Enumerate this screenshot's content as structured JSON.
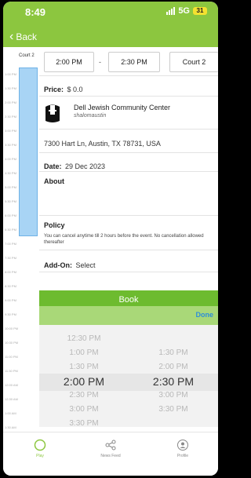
{
  "status_bar": {
    "time": "8:49",
    "network": "5G",
    "battery": "31"
  },
  "nav": {
    "back_label": "Back"
  },
  "schedule": {
    "court_label": "Court 2",
    "time_labels": [
      "1:00 PM",
      "",
      "1:30 PM",
      "",
      "2:00 PM",
      "",
      "2:30 PM",
      "",
      "3:00 PM",
      "",
      "3:30 PM",
      "",
      "4:00 PM",
      "",
      "4:30 PM",
      "",
      "5:00 PM",
      "",
      "5:30 PM",
      "",
      "6:00 PM",
      "",
      "6:30 PM",
      "",
      "7:00 PM",
      "",
      "7:30 PM",
      "",
      "8:00 PM",
      "",
      "8:30 PM",
      "",
      "9:00 PM",
      "",
      "9:30 PM",
      "",
      "10:00 PM",
      "",
      "10:30 PM",
      "",
      "11:00 PM",
      "",
      "11:30 PM",
      "",
      "12:00 AM",
      "",
      "12:30 AM",
      "",
      "1:00 AM",
      "",
      "1:30 AM",
      "",
      "2:00 AM"
    ]
  },
  "booking": {
    "start_time": "2:00 PM",
    "separator": "-",
    "end_time": "2:30 PM",
    "court": "Court 2",
    "price_label": "Price:",
    "price_value": "$ 0.0",
    "org_name": "Dell Jewish Community Center",
    "org_user": "shalomaustin",
    "address": "7300 Hart Ln, Austin, TX 78731, USA",
    "date_label": "Date:",
    "date_value": "29 Dec 2023",
    "about_label": "About",
    "policy_label": "Policy",
    "policy_text": "You can cancel anytime till 2 hours before the event. No cancellation allowed thereafter",
    "addon_label": "Add-On:",
    "addon_value": "Select",
    "book_label": "Book",
    "done_label": "Done"
  },
  "picker": {
    "start_options": [
      "12:30 PM",
      "1:00 PM",
      "1:30 PM",
      "2:00 PM",
      "2:30 PM",
      "3:00 PM",
      "3:30 PM"
    ],
    "end_options": [
      "1:30 PM",
      "2:00 PM",
      "2:30 PM",
      "3:00 PM",
      "3:30 PM"
    ],
    "start_selected": "2:00 PM",
    "end_selected": "2:30 PM"
  },
  "tabs": [
    {
      "label": "Play",
      "icon": "circle-icon",
      "active": true
    },
    {
      "label": "News Feed",
      "icon": "share-icon",
      "active": false
    },
    {
      "label": "Profile",
      "icon": "profile-icon",
      "active": false
    }
  ],
  "colors": {
    "brand_green": "#8cc63f",
    "book_green": "#6dbb2f",
    "schedule_blue": "#a8d4f5",
    "done_blue": "#2e8fd8"
  }
}
